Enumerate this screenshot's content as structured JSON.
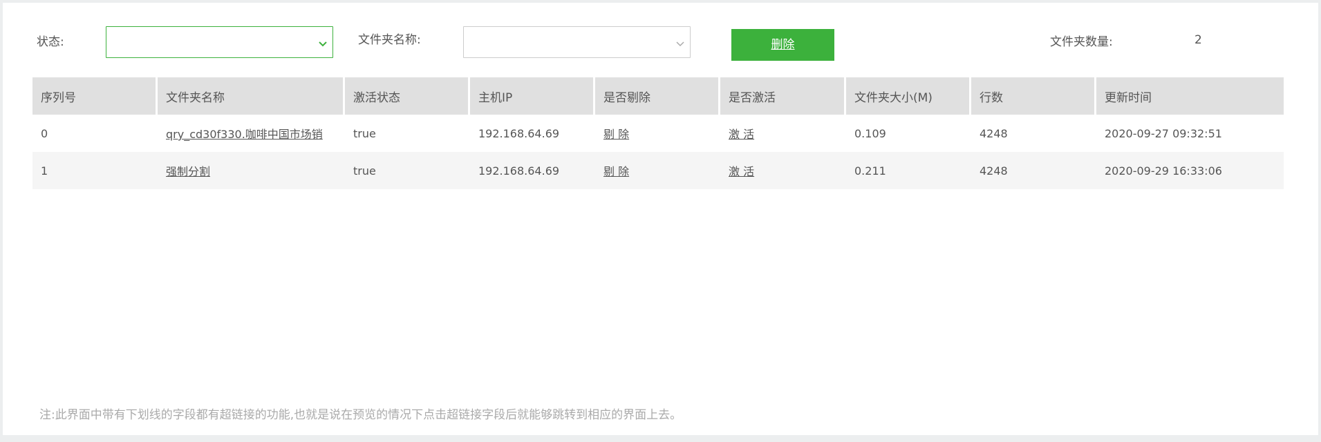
{
  "filters": {
    "status_label": "状态:",
    "status_value": "",
    "folder_name_label": "文件夹名称:",
    "folder_name_value": "",
    "delete_button": "删除",
    "folder_count_label": "文件夹数量:",
    "folder_count_value": "2"
  },
  "colors": {
    "accent": "#3cb13c",
    "header_bg": "#e0e0e0",
    "alt_row_bg": "#f5f5f5",
    "page_bg": "#eceeef"
  },
  "table": {
    "headers": [
      "序列号",
      "文件夹名称",
      "激活状态",
      "主机IP",
      "是否剔除",
      "是否激活",
      "文件夹大小(M)",
      "行数",
      "更新时间"
    ],
    "rows": [
      [
        "0",
        "qry_cd30f330.咖啡中国市场销",
        "true",
        "192.168.64.69",
        "剔 除",
        "激 活",
        "0.109",
        "4248",
        "2020-09-27 09:32:51"
      ],
      [
        "1",
        "强制分割",
        "true",
        "192.168.64.69",
        "剔 除",
        "激 活",
        "0.211",
        "4248",
        "2020-09-29 16:33:06"
      ]
    ]
  },
  "note": "注:此界面中带有下划线的字段都有超链接的功能,也就是说在预览的情况下点击超链接字段后就能够跳转到相应的界面上去。",
  "icons": [
    "chevron-down-icon"
  ]
}
